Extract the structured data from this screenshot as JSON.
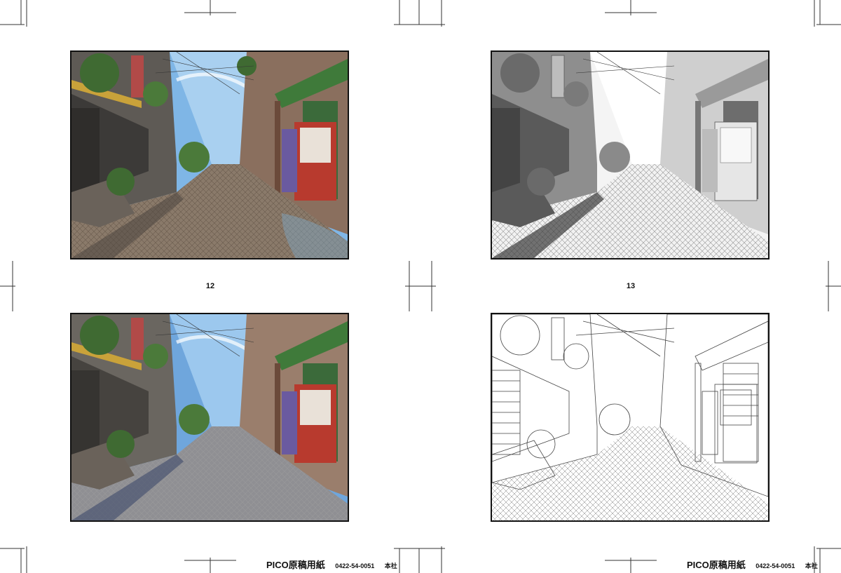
{
  "pages": [
    {
      "page_number": "12"
    },
    {
      "page_number": "13"
    }
  ],
  "footers": [
    {
      "brand": "PICO原稿用紙",
      "phone": "0422-54-0051",
      "office": "本社"
    },
    {
      "brand": "PICO原稿用紙",
      "phone": "0422-54-0051",
      "office": "本社"
    }
  ],
  "panels": [
    {
      "name": "final-color-artwork",
      "style": "color-rain"
    },
    {
      "name": "shaded-pencil-artwork",
      "style": "gray"
    },
    {
      "name": "flat-color-artwork",
      "style": "color-flat"
    },
    {
      "name": "line-art",
      "style": "line"
    }
  ],
  "colors": {
    "frame": "#111111",
    "trim_marks": "#333333",
    "sky": "#7fb6e6",
    "pavement": "#8a7a6a",
    "vending_red": "#b83a2e",
    "awning_green": "#3f7a3a"
  }
}
